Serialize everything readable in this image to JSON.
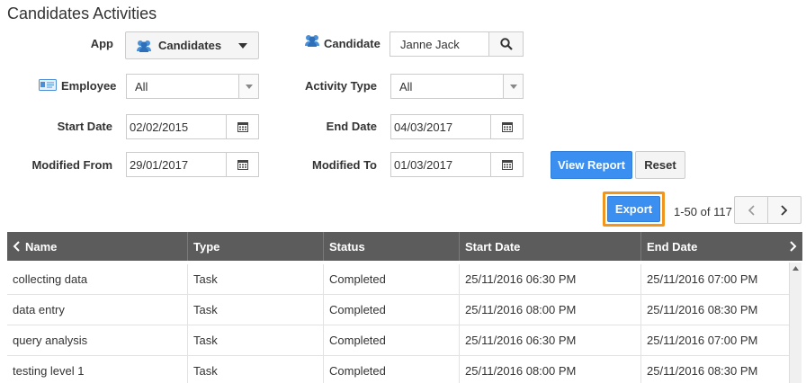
{
  "page": {
    "title": "Candidates Activities"
  },
  "filters": {
    "app_label": "App",
    "app_value": "Candidates",
    "candidate_label": "Candidate",
    "candidate_value": "Janne Jack",
    "employee_label": "Employee",
    "employee_value": "All",
    "activity_type_label": "Activity Type",
    "activity_type_value": "All",
    "start_date_label": "Start Date",
    "start_date_value": "02/02/2015",
    "end_date_label": "End Date",
    "end_date_value": "04/03/2017",
    "modified_from_label": "Modified From",
    "modified_from_value": "29/01/2017",
    "modified_to_label": "Modified To",
    "modified_to_value": "01/03/2017"
  },
  "actions": {
    "view_report": "View Report",
    "reset": "Reset",
    "export": "Export",
    "pagination": "1-50 of 117"
  },
  "table": {
    "headers": [
      "Name",
      "Type",
      "Status",
      "Start Date",
      "End Date"
    ],
    "rows": [
      [
        "collecting data",
        "Task",
        "Completed",
        "25/11/2016 06:30 PM",
        "25/11/2016 07:00 PM"
      ],
      [
        "data entry",
        "Task",
        "Completed",
        "25/11/2016 08:00 PM",
        "25/11/2016 08:30 PM"
      ],
      [
        "query analysis",
        "Task",
        "Completed",
        "25/11/2016 06:30 PM",
        "25/11/2016 07:00 PM"
      ],
      [
        "testing level 1",
        "Task",
        "Completed",
        "25/11/2016 08:00 PM",
        "25/11/2016 08:30 PM"
      ]
    ]
  },
  "colors": {
    "primary_button": "#3b8ff0",
    "export_highlight": "#f0961e",
    "table_header": "#5c5c5c"
  }
}
